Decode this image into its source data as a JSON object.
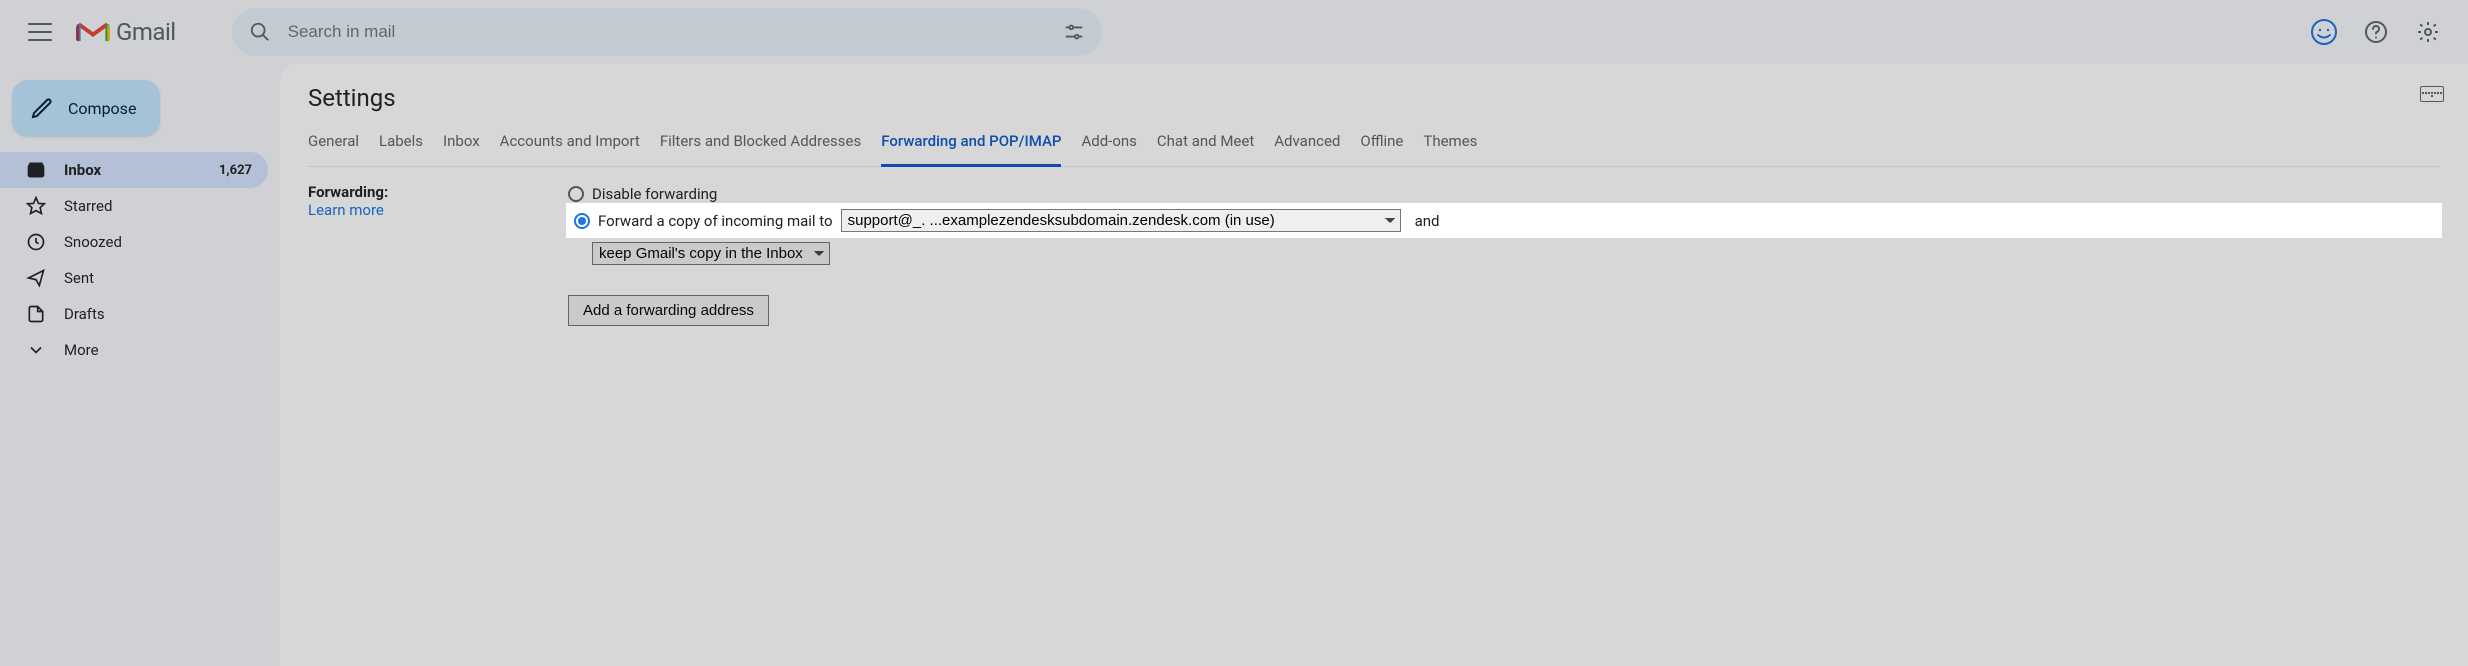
{
  "header": {
    "logo_text": "Gmail",
    "search_placeholder": "Search in mail"
  },
  "compose_label": "Compose",
  "folders": [
    {
      "key": "inbox",
      "label": "Inbox",
      "count": "1,627",
      "active": true
    },
    {
      "key": "starred",
      "label": "Starred",
      "count": "",
      "active": false
    },
    {
      "key": "snoozed",
      "label": "Snoozed",
      "count": "",
      "active": false
    },
    {
      "key": "sent",
      "label": "Sent",
      "count": "",
      "active": false
    },
    {
      "key": "drafts",
      "label": "Drafts",
      "count": "",
      "active": false
    },
    {
      "key": "more",
      "label": "More",
      "count": "",
      "active": false
    }
  ],
  "settings": {
    "title": "Settings",
    "tabs": [
      "General",
      "Labels",
      "Inbox",
      "Accounts and Import",
      "Filters and Blocked Addresses",
      "Forwarding and POP/IMAP",
      "Add-ons",
      "Chat and Meet",
      "Advanced",
      "Offline",
      "Themes"
    ],
    "active_tab": "Forwarding and POP/IMAP",
    "section_label": "Forwarding:",
    "learn_more": "Learn more",
    "disable_label": "Disable forwarding",
    "forward_prefix": "Forward a copy of incoming mail to",
    "address_selected": "support@_. ...examplezendesksubdomain.zendesk.com (in use)",
    "and_word": "and",
    "keep_copy_selected": "keep Gmail's copy in the Inbox",
    "add_address_label": "Add a forwarding address"
  }
}
